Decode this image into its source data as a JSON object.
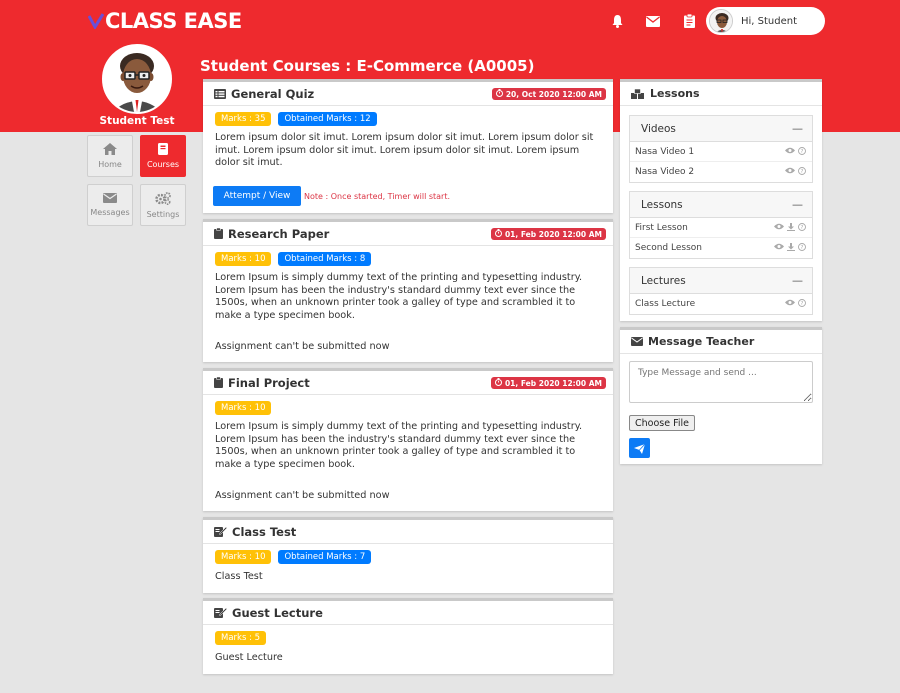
{
  "brand": {
    "name": "CLASS EASE"
  },
  "header": {
    "greeting": "Hi, Student"
  },
  "profile": {
    "name": "Student Test"
  },
  "nav": [
    {
      "label": "Home",
      "icon": "home-icon"
    },
    {
      "label": "Courses",
      "icon": "book-icon"
    },
    {
      "label": "Messages",
      "icon": "envelope-icon"
    },
    {
      "label": "Settings",
      "icon": "gears-icon"
    }
  ],
  "page": {
    "title": "Student Courses : E-Commerce (A0005)"
  },
  "courses": [
    {
      "title": "General Quiz",
      "date": "20, Oct 2020 12:00 AM",
      "marks": "Marks : 35",
      "obtained": "Obtained Marks : 12",
      "text": "Lorem ipsum dolor sit imut. Lorem ipsum dolor sit imut. Lorem ipsum dolor sit imut. Lorem ipsum dolor sit imut. Lorem ipsum dolor sit imut. Lorem ipsum dolor sit imut.",
      "button": "Attempt / View",
      "note": "Note : Once started, Timer will start."
    },
    {
      "title": "Research Paper",
      "date": "01, Feb 2020 12:00 AM",
      "marks": "Marks : 10",
      "obtained": "Obtained Marks : 8",
      "text": "Lorem Ipsum is simply dummy text of the printing and typesetting industry. Lorem Ipsum has been the industry's standard dummy text ever since the 1500s, when an unknown printer took a galley of type and scrambled it to make a type specimen book.",
      "status": "Assignment can't be submitted now"
    },
    {
      "title": "Final Project",
      "date": "01, Feb 2020 12:00 AM",
      "marks": "Marks : 10",
      "text": "Lorem Ipsum is simply dummy text of the printing and typesetting industry. Lorem Ipsum has been the industry's standard dummy text ever since the 1500s, when an unknown printer took a galley of type and scrambled it to make a type specimen book.",
      "status": "Assignment can't be submitted now"
    },
    {
      "title": "Class Test",
      "marks": "Marks : 10",
      "obtained": "Obtained Marks : 7",
      "text": "Class Test"
    },
    {
      "title": "Guest Lecture",
      "marks": "Marks : 5",
      "text": "Guest Lecture"
    }
  ],
  "lessons_panel": {
    "title": "Lessons",
    "groups": [
      {
        "title": "Videos",
        "items": [
          "Nasa Video 1",
          "Nasa Video 2"
        ]
      },
      {
        "title": "Lessons",
        "items": [
          "First Lesson",
          "Second Lesson"
        ]
      },
      {
        "title": "Lectures",
        "items": [
          "Class Lecture"
        ]
      }
    ],
    "collapse_symbol": "—"
  },
  "message_panel": {
    "title": "Message Teacher",
    "placeholder": "Type Message and send ...",
    "file_button": "Choose File"
  },
  "colors": {
    "primary_red": "#ee2a2e",
    "blue": "#007bff",
    "yellow": "#ffc107",
    "danger": "#dc3545"
  }
}
